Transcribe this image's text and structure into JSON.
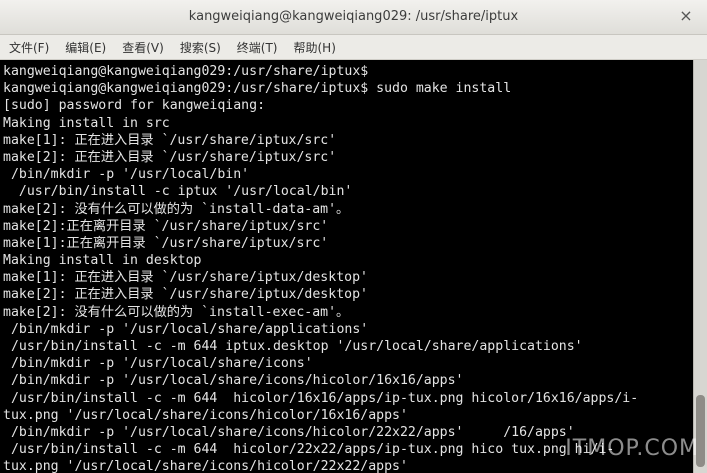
{
  "window": {
    "title": "kangweiqiang@kangweiqiang029: /usr/share/iptux",
    "close_glyph": "×"
  },
  "menubar": {
    "items": [
      "文件(F)",
      "编辑(E)",
      "查看(V)",
      "搜索(S)",
      "终端(T)",
      "帮助(H)"
    ]
  },
  "terminal": {
    "lines": [
      "kangweiqiang@kangweiqiang029:/usr/share/iptux$",
      "kangweiqiang@kangweiqiang029:/usr/share/iptux$ sudo make install",
      "[sudo] password for kangweiqiang:",
      "Making install in src",
      "make[1]: 正在进入目录 `/usr/share/iptux/src'",
      "make[2]: 正在进入目录 `/usr/share/iptux/src'",
      " /bin/mkdir -p '/usr/local/bin'",
      "  /usr/bin/install -c iptux '/usr/local/bin'",
      "make[2]: 没有什么可以做的为 `install-data-am'。",
      "make[2]:正在离开目录 `/usr/share/iptux/src'",
      "make[1]:正在离开目录 `/usr/share/iptux/src'",
      "Making install in desktop",
      "make[1]: 正在进入目录 `/usr/share/iptux/desktop'",
      "make[2]: 正在进入目录 `/usr/share/iptux/desktop'",
      "make[2]: 没有什么可以做的为 `install-exec-am'。",
      " /bin/mkdir -p '/usr/local/share/applications'",
      " /usr/bin/install -c -m 644 iptux.desktop '/usr/local/share/applications'",
      " /bin/mkdir -p '/usr/local/share/icons'",
      " /bin/mkdir -p '/usr/local/share/icons/hicolor/16x16/apps'",
      " /usr/bin/install -c -m 644  hicolor/16x16/apps/ip-tux.png hicolor/16x16/apps/i-",
      "tux.png '/usr/local/share/icons/hicolor/16x16/apps'",
      " /bin/mkdir -p '/usr/local/share/icons/hicolor/22x22/apps'     /16/apps'",
      " /usr/bin/install -c -m 644  hicolor/22x22/apps/ip-tux.png hico tux.png hi/i-",
      "tux.png '/usr/local/share/icons/hicolor/22x22/apps'"
    ]
  },
  "watermark": "ITMOP.COM"
}
